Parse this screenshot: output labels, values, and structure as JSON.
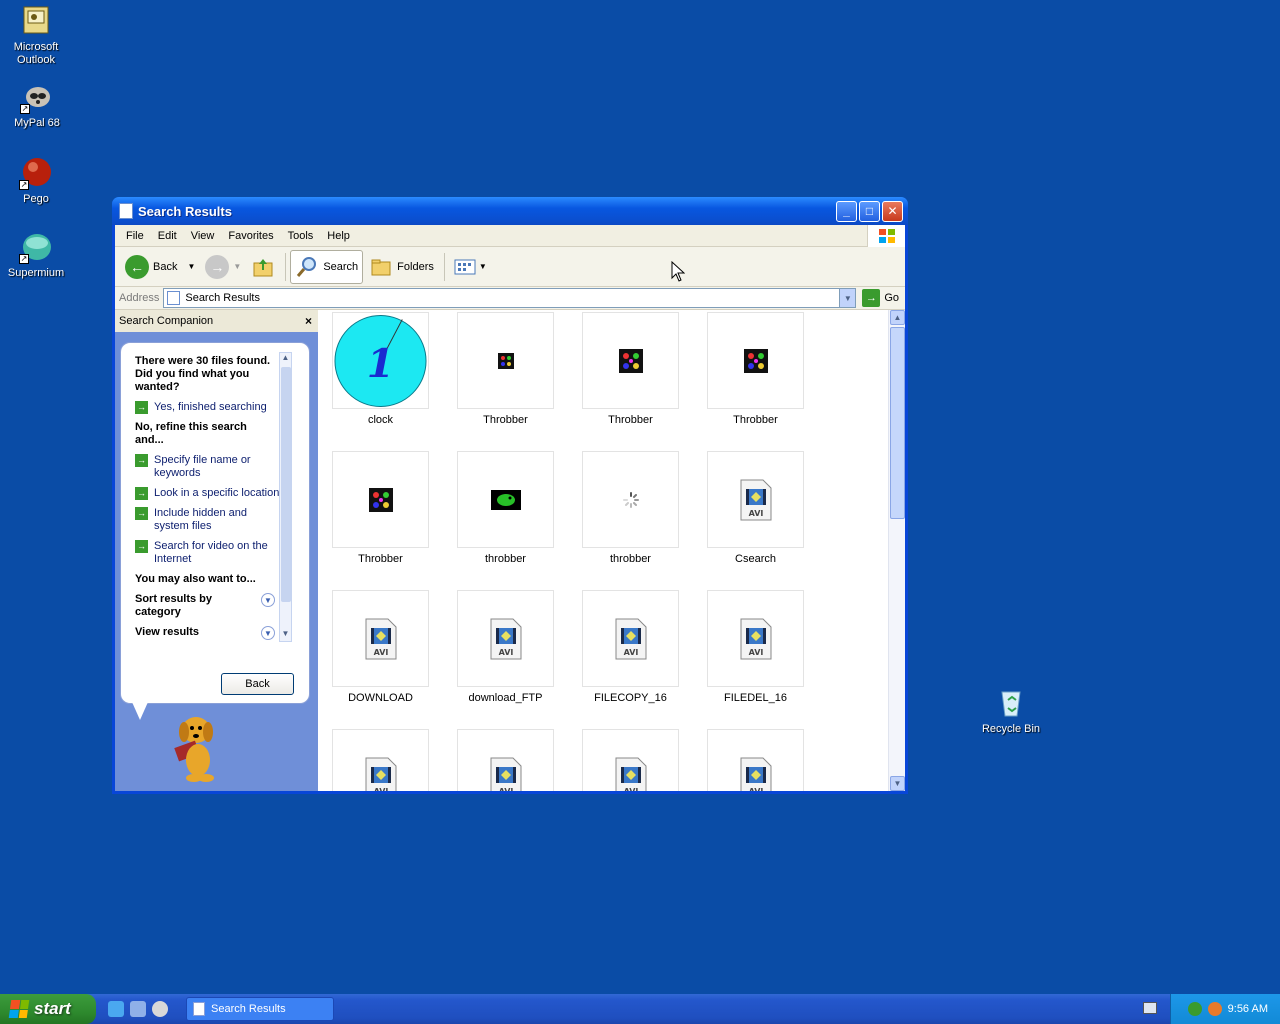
{
  "desktop": {
    "icons": [
      {
        "label": "Microsoft Outlook"
      },
      {
        "label": "MyPal 68"
      },
      {
        "label": "Pego"
      },
      {
        "label": "Supermium"
      },
      {
        "label": "Recycle Bin"
      }
    ]
  },
  "window": {
    "title": "Search Results",
    "menu": [
      "File",
      "Edit",
      "View",
      "Favorites",
      "Tools",
      "Help"
    ],
    "toolbar": {
      "back": "Back",
      "search": "Search",
      "folders": "Folders"
    },
    "address": {
      "label": "Address",
      "value": "Search Results",
      "go": "Go"
    }
  },
  "companion": {
    "header": "Search Companion",
    "close": "×",
    "question": "There were 30 files found. Did you find what you wanted?",
    "yes": "Yes, finished searching",
    "refine_heading": "No, refine this search and...",
    "options": [
      "Specify file name or keywords",
      "Look in a specific location",
      "Include hidden and system files",
      "Search for video on the Internet"
    ],
    "also_heading": "You may also want to...",
    "sort": "Sort results by category",
    "view": "View results",
    "back": "Back"
  },
  "files": [
    {
      "name": "clock",
      "kind": "clock"
    },
    {
      "name": "Throbber",
      "kind": "throbber-small"
    },
    {
      "name": "Throbber",
      "kind": "throbber"
    },
    {
      "name": "Throbber",
      "kind": "throbber"
    },
    {
      "name": "Throbber",
      "kind": "throbber"
    },
    {
      "name": "throbber",
      "kind": "green"
    },
    {
      "name": "throbber",
      "kind": "spinner"
    },
    {
      "name": "Csearch",
      "kind": "avi"
    },
    {
      "name": "DOWNLOAD",
      "kind": "avi"
    },
    {
      "name": "download_FTP",
      "kind": "avi"
    },
    {
      "name": "FILECOPY_16",
      "kind": "avi"
    },
    {
      "name": "FILEDEL_16",
      "kind": "avi"
    },
    {
      "name": "",
      "kind": "avi"
    },
    {
      "name": "",
      "kind": "avi"
    },
    {
      "name": "",
      "kind": "avi"
    },
    {
      "name": "",
      "kind": "avi"
    }
  ],
  "taskbar": {
    "start": "start",
    "task": "Search Results",
    "clock": "9:56 AM"
  },
  "colors": {
    "desktop": "#0a4ca6",
    "titlebar": "#0857e0",
    "start": "#2e8a2e",
    "tray": "#128ad6"
  }
}
